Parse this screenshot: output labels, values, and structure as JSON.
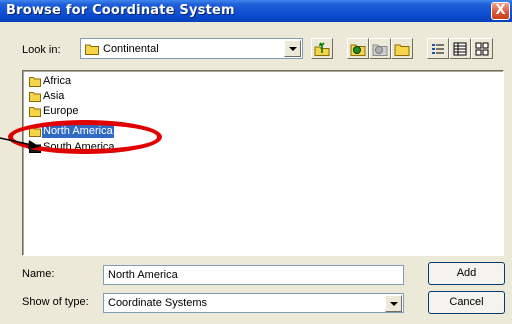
{
  "window": {
    "title": "Browse for Coordinate System",
    "close_glyph": "X"
  },
  "lookin": {
    "label": "Look in:",
    "value": "Continental"
  },
  "toolbar": {
    "buttons": [
      {
        "icon": "up-one-level-icon"
      },
      {
        "icon": "connect-folder-icon"
      },
      {
        "icon": "disconnect-folder-icon"
      },
      {
        "icon": "new-folder-icon"
      },
      {
        "icon": "list-view-icon"
      },
      {
        "icon": "details-view-icon"
      },
      {
        "icon": "thumbnails-view-icon"
      }
    ]
  },
  "files": [
    {
      "label": "Africa",
      "selected": false
    },
    {
      "label": "Asia",
      "selected": false
    },
    {
      "label": "Europe",
      "selected": false
    },
    {
      "label": "North America",
      "selected": true
    },
    {
      "label": "South America",
      "selected": false
    }
  ],
  "annotation": {
    "ellipse_color": "#e00000"
  },
  "name": {
    "label": "Name:",
    "value": "North America"
  },
  "type": {
    "label": "Show of type:",
    "value": "Coordinate Systems"
  },
  "buttons": {
    "add": "Add",
    "cancel": "Cancel"
  },
  "colors": {
    "titlebar": "#0a4bd0",
    "selection": "#316ac5",
    "folder": "#f5d44a"
  }
}
